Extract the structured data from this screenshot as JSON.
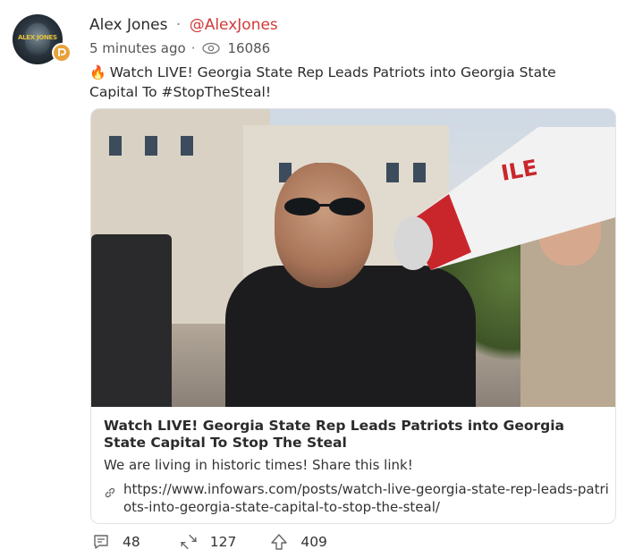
{
  "post": {
    "author_name": "Alex Jones",
    "separator": "·",
    "handle": "@AlexJones",
    "time_ago": "5 minutes ago",
    "meta_separator": "·",
    "view_count": "16086",
    "emoji": "🔥",
    "text": "Watch LIVE! Georgia State Rep Leads Patriots into Georgia State Capital To #StopTheSteal!",
    "avatar_text": "ALEX JONES"
  },
  "link_preview": {
    "title": "Watch LIVE! Georgia State Rep Leads Patriots into Georgia State Capital To Stop The Steal",
    "description": "We are living in historic times! Share this link!",
    "url": "https://www.infowars.com/posts/watch-live-georgia-state-rep-leads-patriots-into-georgia-state-capital-to-stop-the-steal/"
  },
  "actions": {
    "comments": "48",
    "echoes": "127",
    "upvotes": "409"
  },
  "icons": {
    "badge": "parler-badge-icon",
    "views": "eye-icon",
    "link": "link-icon",
    "comment": "comment-icon",
    "echo": "echo-icon",
    "upvote": "upvote-icon"
  },
  "colors": {
    "handle": "#d13a3a",
    "badge": "#e8a23a"
  }
}
